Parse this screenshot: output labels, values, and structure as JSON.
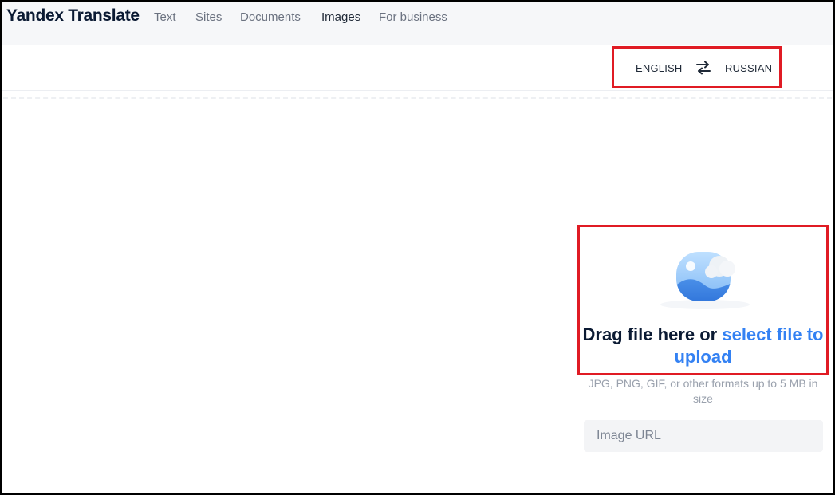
{
  "header": {
    "brand": "Yandex Translate",
    "nav": [
      {
        "label": "Text"
      },
      {
        "label": "Sites"
      },
      {
        "label": "Documents"
      },
      {
        "label": "Images",
        "active": true
      },
      {
        "label": "For business"
      }
    ]
  },
  "languages": {
    "source": "ENGLISH",
    "target": "RUSSIAN",
    "swap_icon": "swap-arrows-icon"
  },
  "upload": {
    "icon": "image-upload-icon",
    "drag_text": "Drag file here or ",
    "select_link": "select file to upload",
    "hint": "JPG, PNG, GIF, or other formats up to 5 MB in size",
    "url_placeholder": "Image URL"
  },
  "colors": {
    "accent_link": "#3381f3",
    "highlight_border": "#e01b24"
  }
}
